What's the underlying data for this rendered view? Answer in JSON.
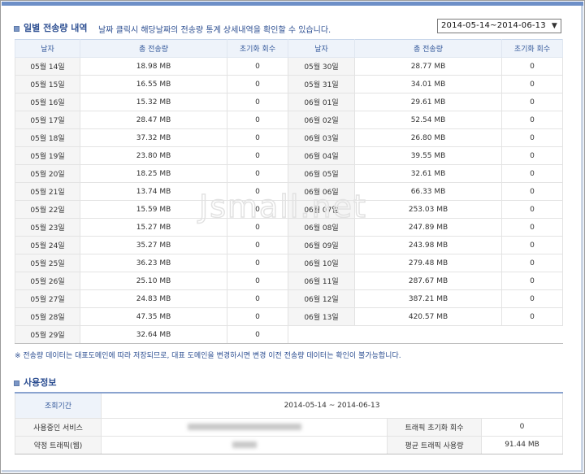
{
  "daily_section": {
    "title": "일별 전송량 내역",
    "description": "날짜 클릭시 해당날짜의 전송량 통계 상세내역을 확인할 수 있습니다.",
    "range_selected": "2014-05-14~2014-06-13"
  },
  "table": {
    "headers": [
      "날자",
      "총 전송량",
      "초기화 회수",
      "날자",
      "총 전송량",
      "초기화 회수"
    ],
    "left": [
      {
        "date": "05월 14일",
        "total": "18.98 MB",
        "resets": "0"
      },
      {
        "date": "05월 15일",
        "total": "16.55 MB",
        "resets": "0"
      },
      {
        "date": "05월 16일",
        "total": "15.32 MB",
        "resets": "0"
      },
      {
        "date": "05월 17일",
        "total": "28.47 MB",
        "resets": "0"
      },
      {
        "date": "05월 18일",
        "total": "37.32 MB",
        "resets": "0"
      },
      {
        "date": "05월 19일",
        "total": "23.80 MB",
        "resets": "0"
      },
      {
        "date": "05월 20일",
        "total": "18.25 MB",
        "resets": "0"
      },
      {
        "date": "05월 21일",
        "total": "13.74 MB",
        "resets": "0"
      },
      {
        "date": "05월 22일",
        "total": "15.59 MB",
        "resets": "0"
      },
      {
        "date": "05월 23일",
        "total": "15.27 MB",
        "resets": "0"
      },
      {
        "date": "05월 24일",
        "total": "35.27 MB",
        "resets": "0"
      },
      {
        "date": "05월 25일",
        "total": "36.23 MB",
        "resets": "0"
      },
      {
        "date": "05월 26일",
        "total": "25.10 MB",
        "resets": "0"
      },
      {
        "date": "05월 27일",
        "total": "24.83 MB",
        "resets": "0"
      },
      {
        "date": "05월 28일",
        "total": "47.35 MB",
        "resets": "0"
      },
      {
        "date": "05월 29일",
        "total": "32.64 MB",
        "resets": "0"
      }
    ],
    "right": [
      {
        "date": "05월 30일",
        "total": "28.77 MB",
        "resets": "0"
      },
      {
        "date": "05월 31일",
        "total": "34.01 MB",
        "resets": "0"
      },
      {
        "date": "06월 01일",
        "total": "29.61 MB",
        "resets": "0"
      },
      {
        "date": "06월 02일",
        "total": "52.54 MB",
        "resets": "0"
      },
      {
        "date": "06월 03일",
        "total": "26.80 MB",
        "resets": "0"
      },
      {
        "date": "06월 04일",
        "total": "39.55 MB",
        "resets": "0"
      },
      {
        "date": "06월 05일",
        "total": "32.61 MB",
        "resets": "0"
      },
      {
        "date": "06월 06일",
        "total": "66.33 MB",
        "resets": "0"
      },
      {
        "date": "06월 07일",
        "total": "253.03 MB",
        "resets": "0"
      },
      {
        "date": "06월 08일",
        "total": "247.89 MB",
        "resets": "0"
      },
      {
        "date": "06월 09일",
        "total": "243.98 MB",
        "resets": "0"
      },
      {
        "date": "06월 10일",
        "total": "279.48 MB",
        "resets": "0"
      },
      {
        "date": "06월 11일",
        "total": "287.67 MB",
        "resets": "0"
      },
      {
        "date": "06월 12일",
        "total": "387.21 MB",
        "resets": "0"
      },
      {
        "date": "06월 13일",
        "total": "420.57 MB",
        "resets": "0"
      }
    ]
  },
  "notice": "※ 전송량 데이터는 대표도메인에 따라 저장되므로, 대표 도메인을 변경하시면 변경 이전 전송량 데이터는 확인이 불가능합니다.",
  "usage": {
    "title": "사용정보",
    "period_label": "조회기간",
    "period_value": "2014-05-14 ~ 2014-06-13",
    "service_label": "사용중인 서비스",
    "reset_label": "트래픽 초기화 회수",
    "reset_value": "0",
    "contract_label": "약정 트래픽(웹)",
    "avg_label": "평균 트래픽 사용량",
    "avg_value": "91.44 MB"
  },
  "watermark": "Jsmall.net",
  "icons": {
    "section_bullet": "square-bullet-icon",
    "select_caret": "chevron-down-icon"
  },
  "colors": {
    "accent": "#2d4f92",
    "header_bg": "#eef3fa",
    "date_bg": "#f5f5f5"
  }
}
